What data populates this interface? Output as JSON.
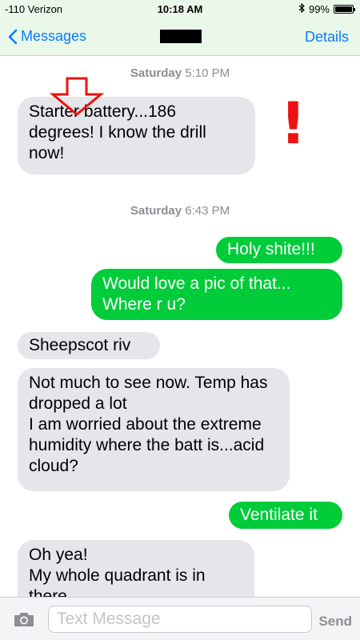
{
  "status_bar": {
    "carrier": "-110 Verizon",
    "time": "10:18 AM",
    "battery_label": "99%",
    "battery_level": 0.99
  },
  "nav": {
    "back_label": "Messages",
    "details_label": "Details"
  },
  "conversation": [
    {
      "type": "timestamp",
      "day": "Saturday",
      "time": "5:10 PM"
    },
    {
      "type": "incoming",
      "text": "Starter battery...186 degrees! I know the drill now!"
    },
    {
      "type": "timestamp",
      "day": "Saturday",
      "time": "6:43 PM"
    },
    {
      "type": "outgoing",
      "text": "Holy shite!!!"
    },
    {
      "type": "outgoing",
      "text": "Would love a pic of that... Where r u?"
    },
    {
      "type": "incoming",
      "text": "Sheepscot riv"
    },
    {
      "type": "incoming",
      "text": "Not much to see now. Temp has dropped a lot\nI am worried about the extreme humidity where the batt is...acid cloud?"
    },
    {
      "type": "outgoing",
      "text": "Ventilate it"
    },
    {
      "type": "incoming",
      "text": "Oh yea!\nMy whole quadrant is in there"
    }
  ],
  "annotations": {
    "exclamation": "!"
  },
  "input": {
    "placeholder": "Text Message",
    "send_label": "Send"
  },
  "colors": {
    "accent": "#0a7cff",
    "outgoing_bubble": "#00cc3a",
    "incoming_bubble": "#e5e5ea",
    "annotation": "#ee1111"
  }
}
